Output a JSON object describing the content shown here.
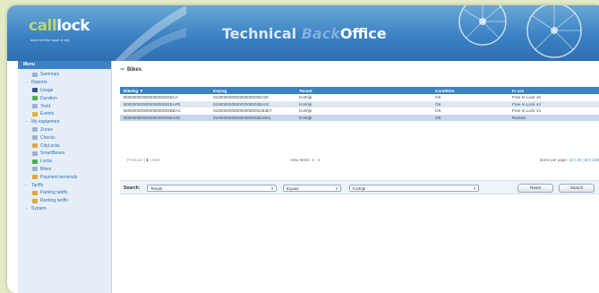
{
  "header": {
    "logo_call": "call",
    "logo_lock": "lock",
    "logo_tagline": "world of bike sport & city",
    "title_part1": "Technical ",
    "title_part2": "Back",
    "title_part3": "Office"
  },
  "sidebar": {
    "heading": "Menu",
    "items": [
      {
        "label": "Summary",
        "level": 2,
        "icon": "summary-icon",
        "color": "#9bb3cf"
      },
      {
        "label": "Reports",
        "level": 1,
        "toggle": "minus"
      },
      {
        "label": "Usage",
        "level": 2,
        "icon": "usage-icon",
        "color": "#3a4f8f"
      },
      {
        "label": "Duration",
        "level": 2,
        "icon": "duration-icon",
        "color": "#4caf50"
      },
      {
        "label": "Yield",
        "level": 2,
        "icon": "yield-icon",
        "color": "#9bb3cf"
      },
      {
        "label": "Events",
        "level": 2,
        "icon": "events-icon",
        "color": "#e0b23a"
      },
      {
        "label": "My equipment",
        "level": 1,
        "toggle": "minus"
      },
      {
        "label": "Zones",
        "level": 2,
        "icon": "zones-icon",
        "color": "#9bb3cf"
      },
      {
        "label": "Checks",
        "level": 2,
        "icon": "checks-icon",
        "color": "#9bb3cf"
      },
      {
        "label": "CityLocks",
        "level": 2,
        "icon": "citylocks-icon",
        "color": "#e0a53a"
      },
      {
        "label": "SmartBoxes",
        "level": 2,
        "icon": "smartboxes-icon",
        "color": "#9bb3cf"
      },
      {
        "label": "Locks",
        "level": 2,
        "icon": "locks-icon",
        "color": "#4caf50"
      },
      {
        "label": "Bikes",
        "level": 2,
        "icon": "bikes-icon",
        "color": "#9bb3cf"
      },
      {
        "label": "Payment terminals",
        "level": 2,
        "icon": "payment-icon",
        "color": "#e0a53a"
      },
      {
        "label": "Tariffs",
        "level": 1,
        "toggle": "minus"
      },
      {
        "label": "Parking tariffs",
        "level": 2,
        "icon": "parking-icon",
        "color": "#e0a53a"
      },
      {
        "label": "Renting tariffs",
        "level": 2,
        "icon": "renting-icon",
        "color": "#e0a53a"
      },
      {
        "label": "System",
        "level": 1,
        "toggle": "minus"
      }
    ]
  },
  "main": {
    "page_title": "Bikes",
    "columns": [
      "Bikeleg",
      "Keytag",
      "Tenant",
      "Condition",
      "In use"
    ],
    "rows": [
      [
        "B0000000000000000003EAA",
        "01000000000000000000E220",
        "Kortrijk",
        "OK",
        "Free In Lock 16"
      ],
      [
        "B0000000000000000003EAFE",
        "01000000000000000003BA0C",
        "Kortrijk",
        "OK",
        "Free In Lock 44"
      ],
      [
        "B0000000000000000003BBAC",
        "01000000000000000004CB4E7",
        "Kortrijk",
        "OK",
        "Free In Lock 14"
      ],
      [
        "B0000000000000000003E44D",
        "01000000000000000003E3461",
        "Kortrijk",
        "OK",
        "Rented"
      ]
    ],
    "sort_indicator": "▼",
    "pager": {
      "prev": "Previous",
      "page": "1",
      "next": "Next",
      "view": "View items: 1 - 4",
      "per_page_label": "Items per page:",
      "per_page_options": "10 | 20 | 50 | 100"
    },
    "search": {
      "label": "Search:",
      "field1": "Tenant",
      "field2": "Equals",
      "field3": "Kortrijk",
      "reset": "Reset",
      "search": "Search"
    }
  }
}
